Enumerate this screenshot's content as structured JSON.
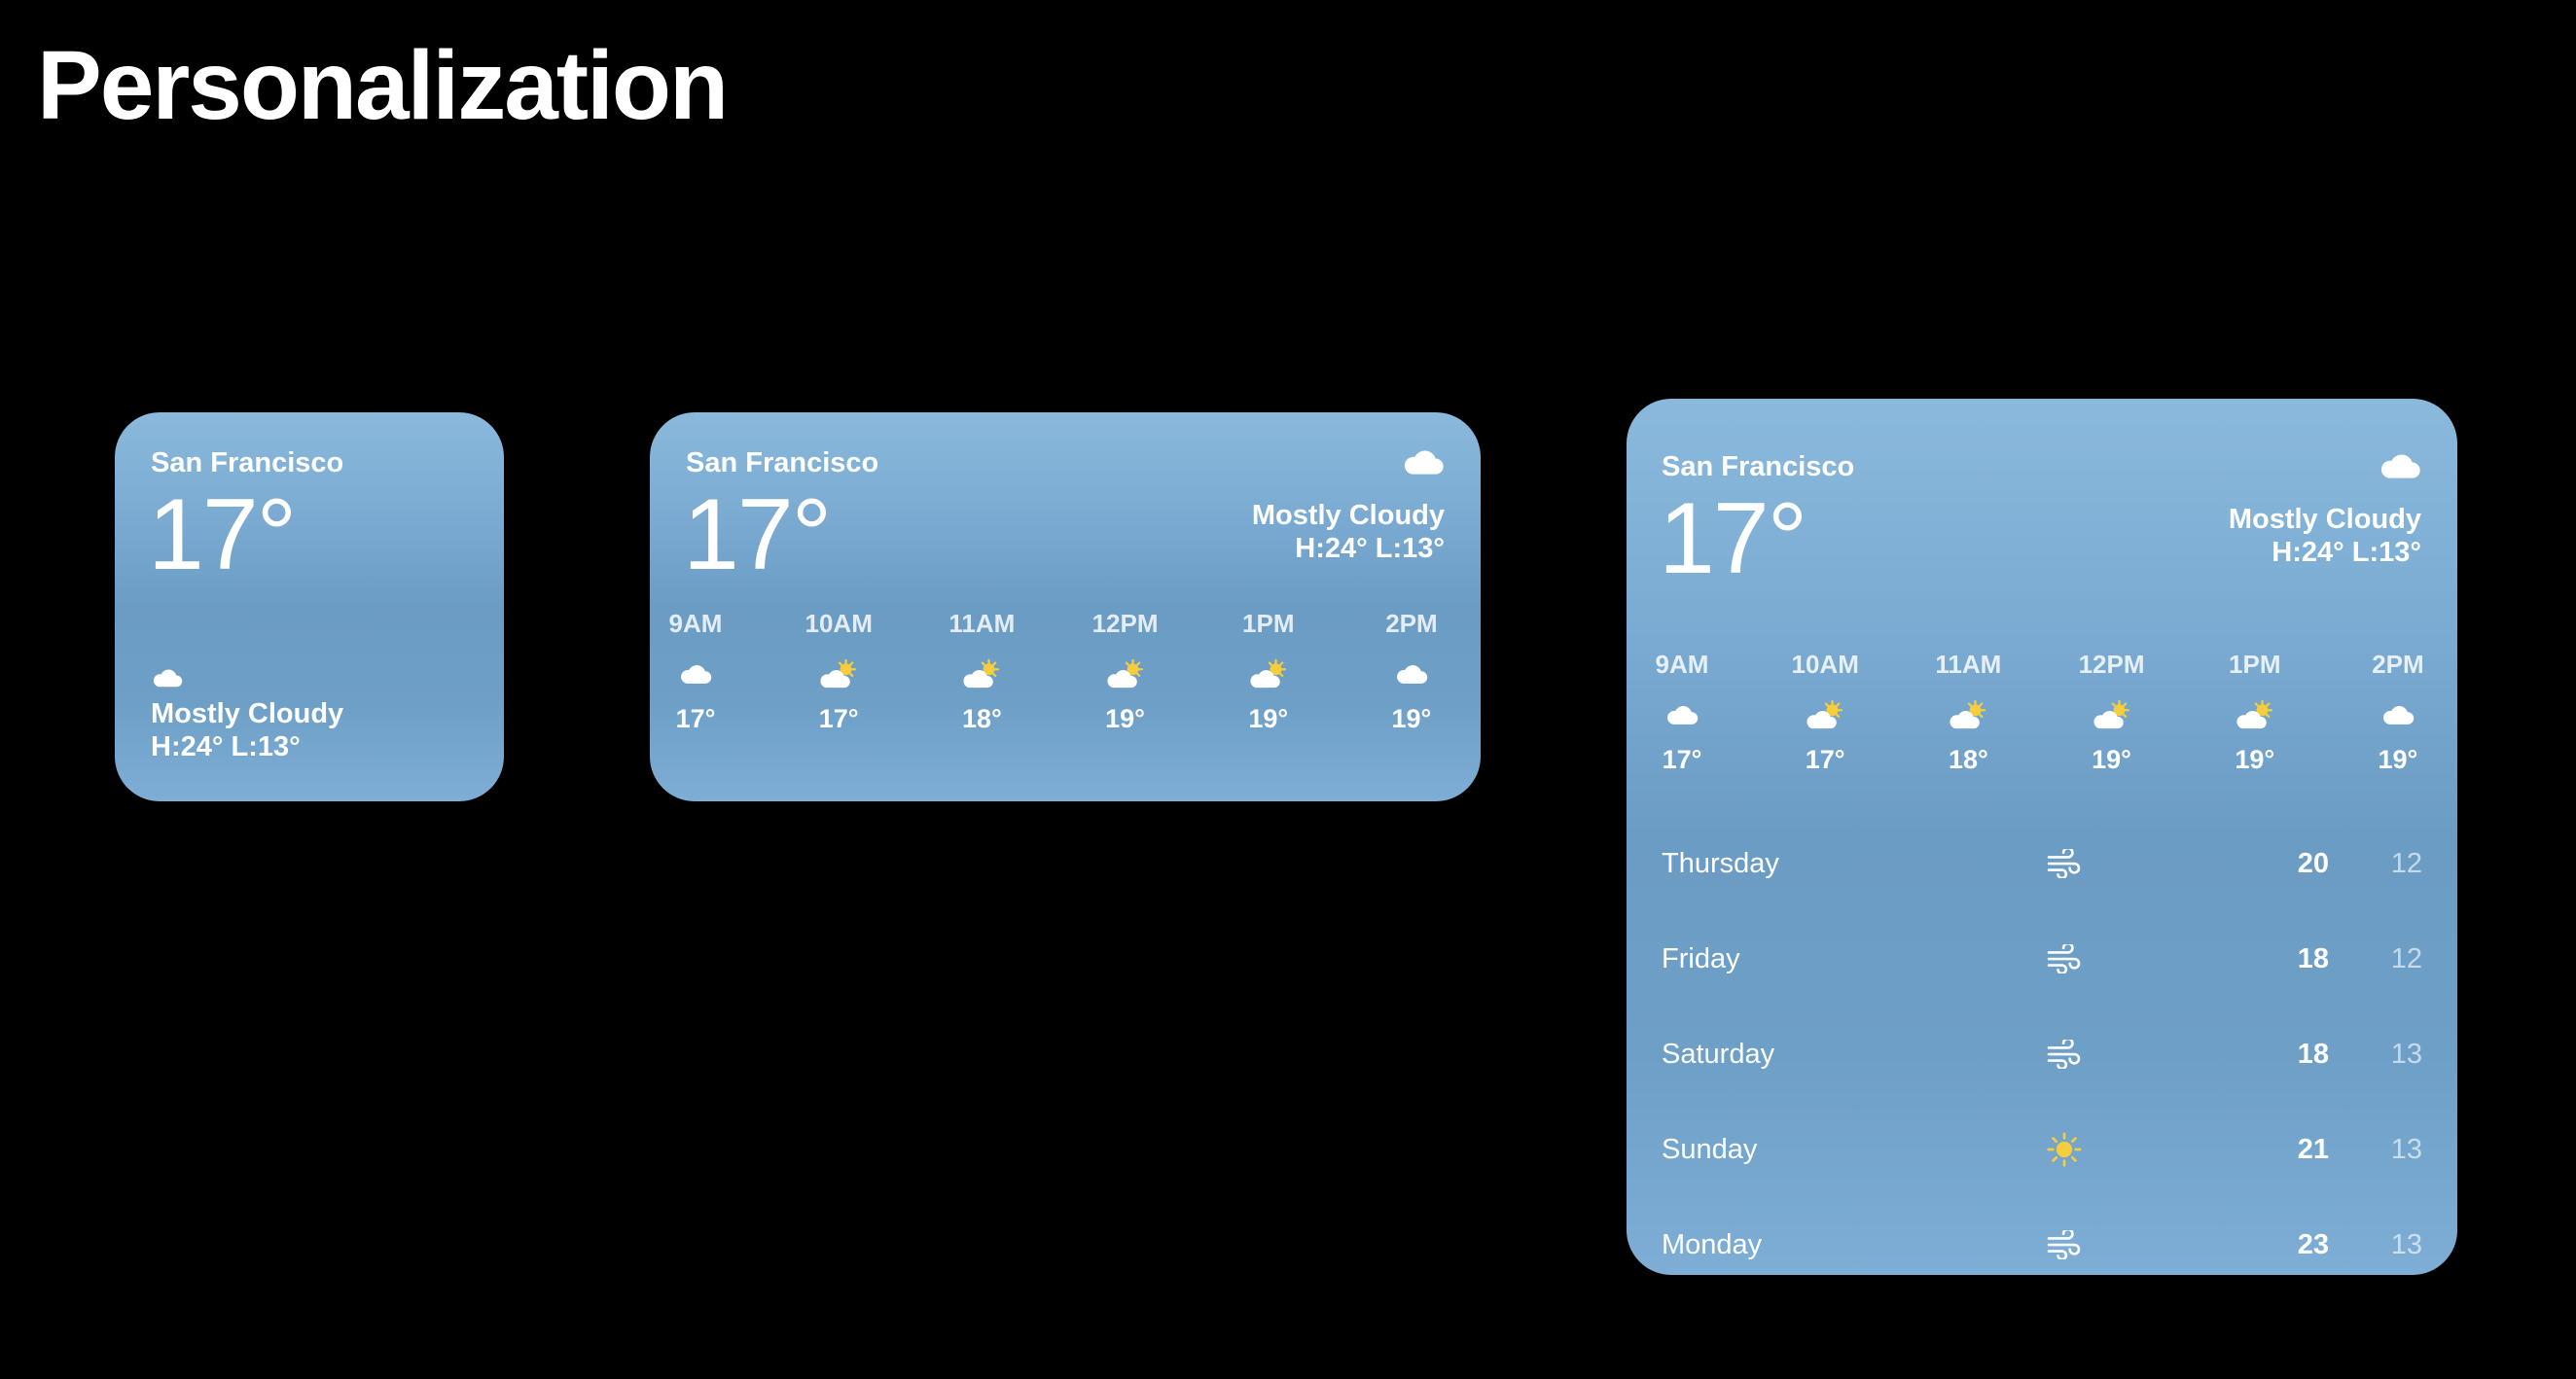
{
  "title": "Personalization",
  "colors": {
    "background": "#000000",
    "widget_top": "#8ab9dc",
    "widget_mid": "#6b9cc4",
    "sun": "#f6cd3c"
  },
  "small_widget": {
    "city": "San Francisco",
    "temp": "17°",
    "condition_icon": "cloud-icon",
    "condition": "Mostly Cloudy",
    "hilo": "H:24° L:13°"
  },
  "medium_widget": {
    "city": "San Francisco",
    "temp": "17°",
    "condition_icon": "cloud-icon",
    "condition": "Mostly Cloudy",
    "hilo": "H:24° L:13°",
    "hours": [
      {
        "time": "9AM",
        "icon": "cloud-icon",
        "temp": "17°"
      },
      {
        "time": "10AM",
        "icon": "partly-sunny-icon",
        "temp": "17°"
      },
      {
        "time": "11AM",
        "icon": "partly-sunny-icon",
        "temp": "18°"
      },
      {
        "time": "12PM",
        "icon": "partly-sunny-icon",
        "temp": "19°"
      },
      {
        "time": "1PM",
        "icon": "partly-sunny-icon",
        "temp": "19°"
      },
      {
        "time": "2PM",
        "icon": "cloud-icon",
        "temp": "19°"
      }
    ]
  },
  "large_widget": {
    "city": "San Francisco",
    "temp": "17°",
    "condition_icon": "cloud-icon",
    "condition": "Mostly Cloudy",
    "hilo": "H:24° L:13°",
    "hours": [
      {
        "time": "9AM",
        "icon": "cloud-icon",
        "temp": "17°"
      },
      {
        "time": "10AM",
        "icon": "partly-sunny-icon",
        "temp": "17°"
      },
      {
        "time": "11AM",
        "icon": "partly-sunny-icon",
        "temp": "18°"
      },
      {
        "time": "12PM",
        "icon": "partly-sunny-icon",
        "temp": "19°"
      },
      {
        "time": "1PM",
        "icon": "partly-sunny-icon",
        "temp": "19°"
      },
      {
        "time": "2PM",
        "icon": "cloud-icon",
        "temp": "19°"
      }
    ],
    "days": [
      {
        "name": "Thursday",
        "icon": "wind-icon",
        "high": "20",
        "low": "12"
      },
      {
        "name": "Friday",
        "icon": "wind-icon",
        "high": "18",
        "low": "12"
      },
      {
        "name": "Saturday",
        "icon": "wind-icon",
        "high": "18",
        "low": "13"
      },
      {
        "name": "Sunday",
        "icon": "sun-icon",
        "high": "21",
        "low": "13"
      },
      {
        "name": "Monday",
        "icon": "wind-icon",
        "high": "23",
        "low": "13"
      }
    ]
  }
}
